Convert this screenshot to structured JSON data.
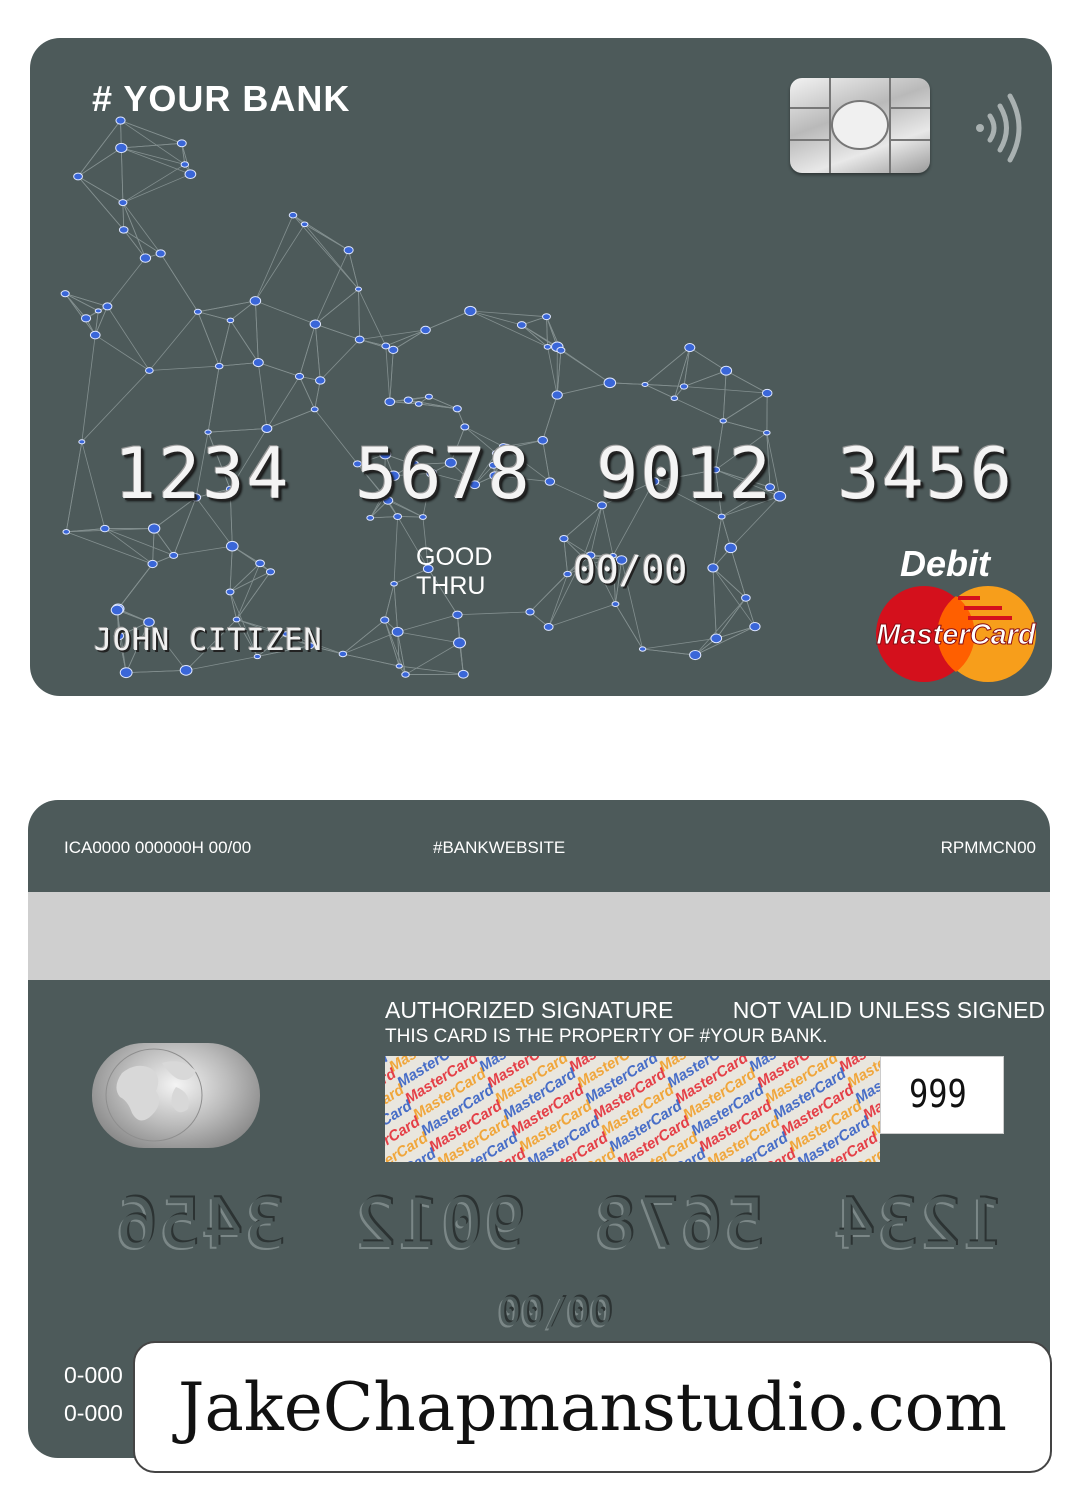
{
  "front": {
    "bank_name": "# YOUR BANK",
    "card_number_groups": [
      "1234",
      "5678",
      "9012",
      "3456"
    ],
    "good_thru": "GOOD\nTHRU",
    "expiry": "00/00",
    "holder_name": "JOHN CITIZEN",
    "card_type": "Debit",
    "network_logo_text": "MasterCard",
    "icons": [
      "chip-icon",
      "contactless-icon",
      "mastercard-logo"
    ],
    "colors": {
      "card_bg": "#4d5a5a",
      "network_dot": "#3a66d8",
      "mc_red": "#d4101c",
      "mc_orange": "#f79e1b"
    }
  },
  "back": {
    "ica_line": "ICA0000 000000H 00/00",
    "website": "#BANKWEBSITE",
    "code": "RPMMCN00",
    "authorized_signature": "AUTHORIZED SIGNATURE",
    "not_valid": "NOT VALID UNLESS SIGNED",
    "property_text": "THIS CARD IS THE PROPERTY OF #YOUR BANK.",
    "signature_pattern_text": "MasterCard",
    "cvv": "999",
    "card_number_groups": [
      "1234",
      "5678",
      "9012",
      "3456"
    ],
    "expiry": "00\\00",
    "phone_1": "0-000",
    "phone_2": "0-000",
    "icons": [
      "hologram-globe-icon"
    ]
  },
  "watermark": {
    "text": "JakeChapmanstudio.com"
  }
}
